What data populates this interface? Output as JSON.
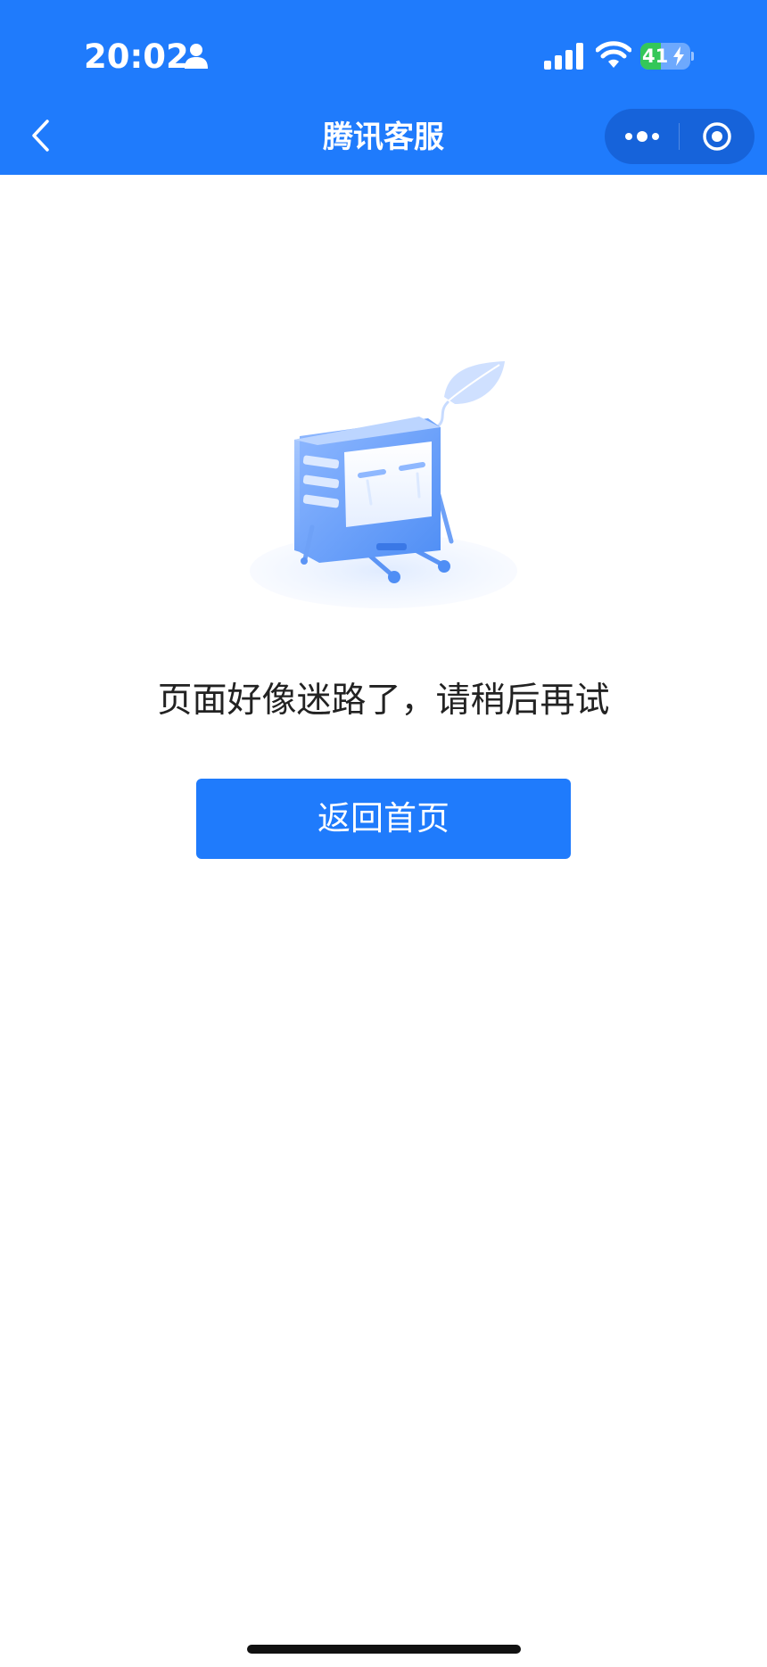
{
  "status_bar": {
    "time": "20:02",
    "battery": "41",
    "battery_level_percent": 41,
    "icons": [
      "person-icon",
      "cellular-signal-icon",
      "wifi-icon",
      "battery-icon",
      "charging-bolt-icon"
    ]
  },
  "nav": {
    "title": "腾讯客服",
    "back_icon": "chevron-left-icon",
    "more_icon": "more-dots-icon",
    "close_icon": "target-circle-icon"
  },
  "main": {
    "illustration": "lost-computer-illustration",
    "message": "页面好像迷路了，请稍后再试",
    "home_button_label": "返回首页"
  },
  "colors": {
    "brand": "#1f7bfc",
    "text": "#222222",
    "battery": "#34c759",
    "background": "#ffffff"
  }
}
